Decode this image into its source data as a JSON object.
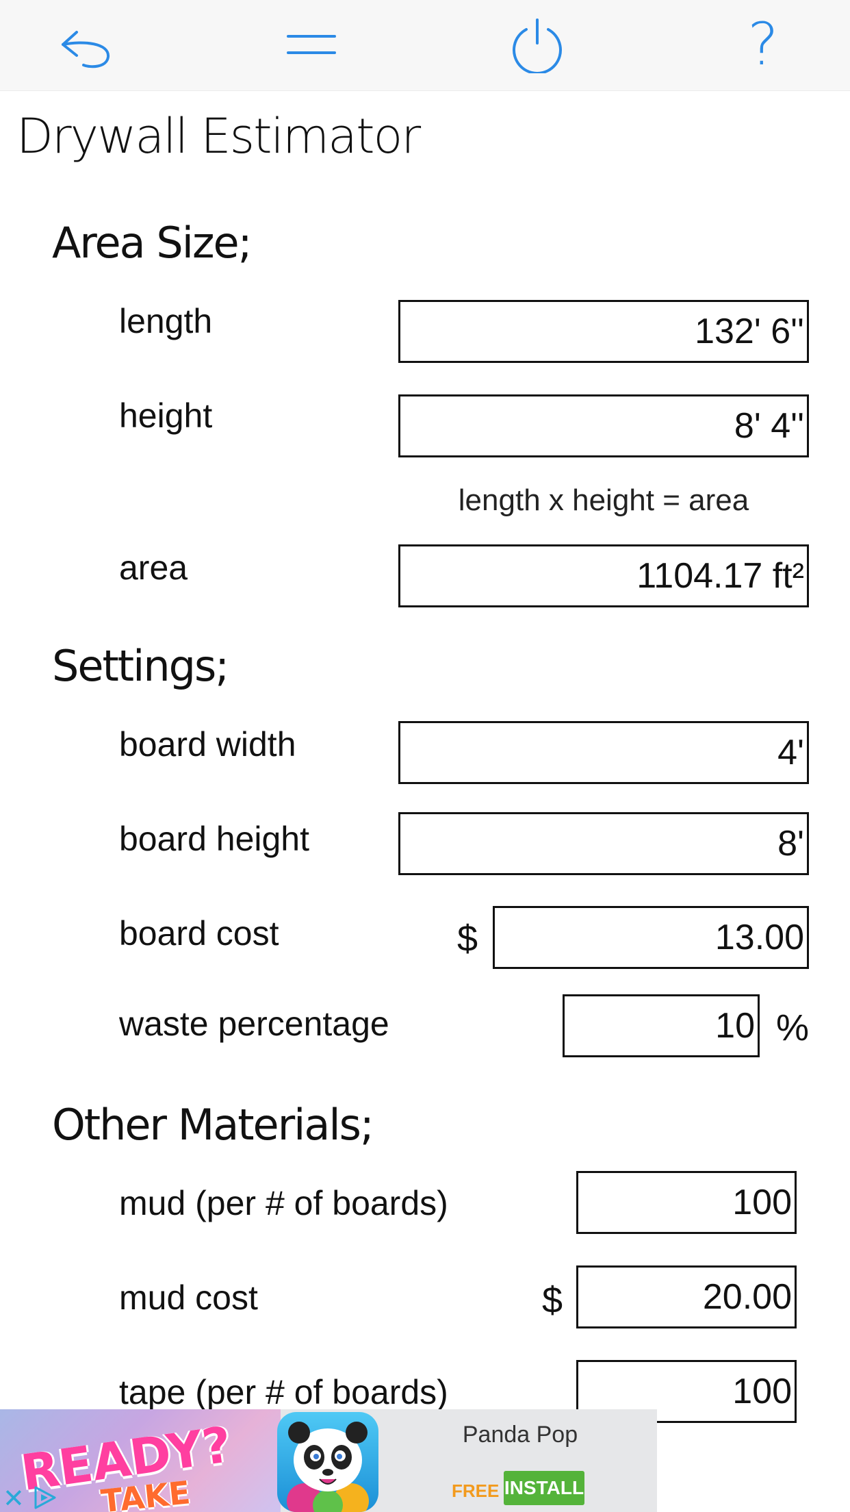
{
  "toolbar": {
    "buttons": [
      {
        "icon": "undo-arrow-icon",
        "color": "#2b8ae6"
      },
      {
        "icon": "menu-icon",
        "color": "#2b8ae6"
      },
      {
        "icon": "power-icon",
        "color": "#2b8ae6"
      },
      {
        "icon": "help-icon",
        "color": "#2b8ae6",
        "glyph": "?"
      }
    ]
  },
  "title": "Drywall Estimator",
  "area_section": {
    "heading": "Area Size;",
    "length": {
      "label": "length",
      "value": "132' 6''"
    },
    "height": {
      "label": "height",
      "value": "8' 4''"
    },
    "formula_note": "length x height = area",
    "area": {
      "label": "area",
      "value": "1104.17 ft²"
    }
  },
  "settings_section": {
    "heading": "Settings;",
    "board_width": {
      "label": "board width",
      "value": "4'"
    },
    "board_height": {
      "label": "board height",
      "value": "8'"
    },
    "board_cost": {
      "label": "board cost",
      "prefix": "$",
      "value": "13.00"
    },
    "waste_percentage": {
      "label": "waste percentage",
      "value": "10",
      "suffix": "%"
    }
  },
  "materials_section": {
    "heading": "Other Materials;",
    "mud_per_boards": {
      "label": "mud (per # of boards)",
      "value": "100"
    },
    "mud_cost": {
      "label": "mud cost",
      "prefix": "$",
      "value": "20.00"
    },
    "tape_per_boards": {
      "label": "tape (per # of boards)",
      "value": "100"
    }
  },
  "ad": {
    "headline_1": "READY?",
    "headline_2": "TAKE AIM!",
    "app_name": "Panda Pop",
    "price": "FREE",
    "install_label": "INSTALL"
  }
}
